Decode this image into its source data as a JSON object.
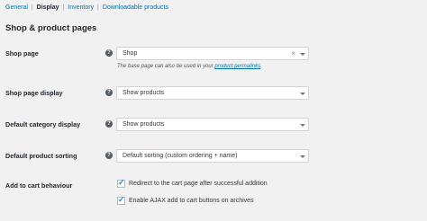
{
  "subnav": {
    "general": "General",
    "display": "Display",
    "inventory": "Inventory",
    "downloadable": "Downloadable products",
    "separator": "|"
  },
  "heading": "Shop & product pages",
  "help_icon": "?",
  "shop_page": {
    "label": "Shop page",
    "value": "Shop",
    "clear": "×",
    "desc_prefix": "The base page can also be used in your ",
    "desc_link": "product permalinks",
    "desc_suffix": "."
  },
  "shop_page_display": {
    "label": "Shop page display",
    "value": "Show products"
  },
  "default_category_display": {
    "label": "Default category display",
    "value": "Show products"
  },
  "default_product_sorting": {
    "label": "Default product sorting",
    "value": "Default sorting (custom ordering + name)"
  },
  "add_to_cart": {
    "label": "Add to cart behaviour",
    "options": [
      {
        "label": "Redirect to the cart page after successful addition",
        "checked": true
      },
      {
        "label": "Enable AJAX add to cart buttons on archives",
        "checked": true
      }
    ],
    "check_mark": "✓"
  }
}
